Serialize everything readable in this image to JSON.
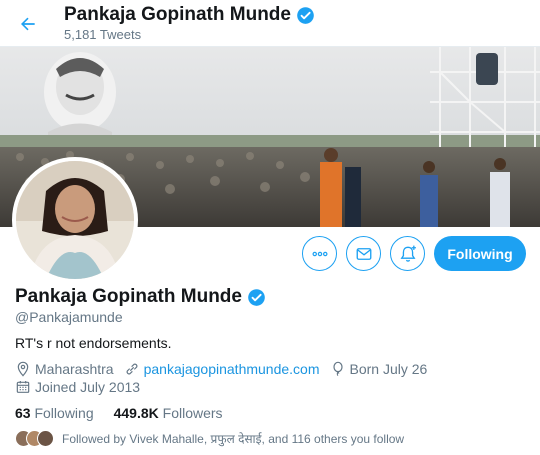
{
  "header": {
    "name": "Pankaja Gopinath Munde",
    "tweet_count": "5,181 Tweets"
  },
  "profile": {
    "name": "Pankaja Gopinath Munde",
    "handle": "@Pankajamunde",
    "bio": "RT's r not endorsements.",
    "location": "Maharashtra",
    "website": "pankajagopinathmunde.com",
    "birthday": "Born July 26",
    "joined": "Joined July 2013"
  },
  "stats": {
    "following_count": "63",
    "following_label": "Following",
    "followers_count": "449.8K",
    "followers_label": "Followers"
  },
  "followed_by": "Followed by Vivek Mahalle, प्रफुल देसाई, and 116 others you follow",
  "actions": {
    "follow_label": "Following"
  },
  "colors": {
    "accent": "#1da1f2",
    "link": "#1b95e0",
    "secondary_text": "#657786"
  }
}
